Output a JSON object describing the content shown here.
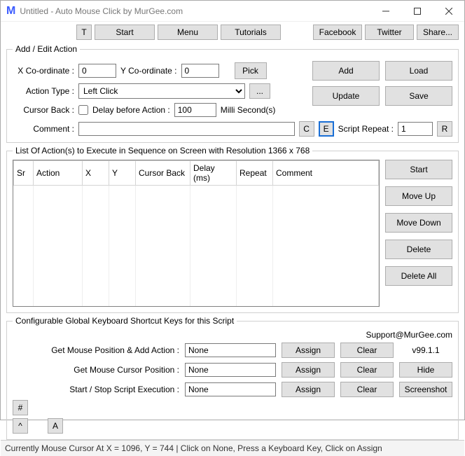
{
  "window": {
    "title": "Untitled - Auto Mouse Click by MurGee.com"
  },
  "topbar": {
    "t": "T",
    "start": "Start",
    "menu": "Menu",
    "tutorials": "Tutorials",
    "facebook": "Facebook",
    "twitter": "Twitter",
    "share": "Share..."
  },
  "addedit": {
    "legend": "Add / Edit Action",
    "x_label": "X Co-ordinate :",
    "x_value": "0",
    "y_label": "Y Co-ordinate :",
    "y_value": "0",
    "pick": "Pick",
    "action_type_label": "Action Type :",
    "action_type_value": "Left Click",
    "more": "...",
    "cursor_back_label": "Cursor Back :",
    "delay_label": "Delay before Action :",
    "delay_value": "100",
    "ms_label": "Milli Second(s)",
    "comment_label": "Comment :",
    "comment_value": "",
    "c": "C",
    "e": "E",
    "script_repeat_label": "Script Repeat :",
    "script_repeat_value": "1",
    "r": "R",
    "add": "Add",
    "load": "Load",
    "update": "Update",
    "save": "Save"
  },
  "list": {
    "legend": "List Of Action(s) to Execute in Sequence on Screen with Resolution 1366 x 768",
    "cols": {
      "sr": "Sr",
      "action": "Action",
      "x": "X",
      "y": "Y",
      "cursor_back": "Cursor Back",
      "delay": "Delay (ms)",
      "repeat": "Repeat",
      "comment": "Comment"
    },
    "btns": {
      "start": "Start",
      "moveup": "Move Up",
      "movedown": "Move Down",
      "delete": "Delete",
      "deleteall": "Delete All"
    }
  },
  "shortcuts": {
    "legend": "Configurable Global Keyboard Shortcut Keys for this Script",
    "support": "Support@MurGee.com",
    "version": "v99.1.1",
    "rows": {
      "r1_label": "Get Mouse Position & Add Action :",
      "r2_label": "Get Mouse Cursor Position :",
      "r3_label": "Start / Stop Script Execution :",
      "none": "None",
      "assign": "Assign",
      "clear": "Clear",
      "hide": "Hide",
      "screenshot": "Screenshot"
    },
    "hash": "#",
    "caret": "^",
    "a": "A"
  },
  "status": "Currently Mouse Cursor At X = 1096, Y = 744 | Click on None, Press a Keyboard Key, Click on Assign"
}
